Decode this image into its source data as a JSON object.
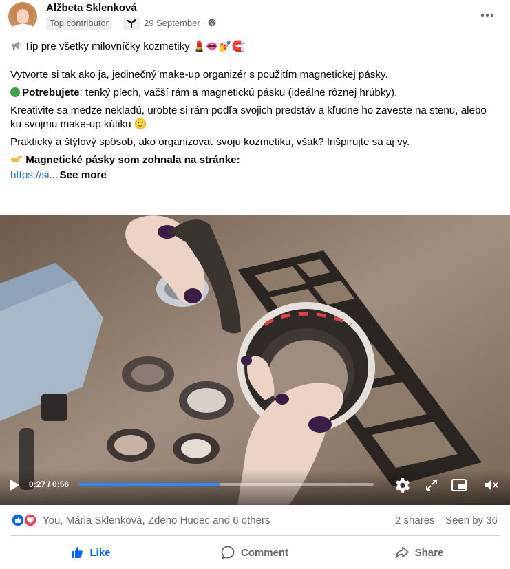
{
  "post": {
    "author": "Alžbeta Sklenková",
    "badge": "Top contributor",
    "date": "29 September",
    "separator": "·",
    "headline": "Tip pre všetky milovníčky kozmetiky",
    "headline_emojis": "💄👄💅🧲",
    "para1": "Vytvorte si tak ako ja, jedinečný make-up organizér s použitím magnetickej pásky.",
    "para2_bold": "Potrebujete",
    "para2_rest": ": tenký plech, väčší rám a magnetickú pásku (ideálne rôznej hrúbky).",
    "para3": "Kreativite sa medze nekladú, urobte si rám podľa svojich predstáv a kľudne ho zaveste na stenu, alebo ku svojmu make-up kútiku 🙂",
    "para4": "Praktický a štýlový spôsob, ako organizovať svoju kozmetiku, však? Inšpirujte sa aj vy.",
    "para5_bold": "Magnetické pásky som zohnala na stránke:",
    "link_text": "https://si",
    "ellipsis": "...",
    "see_more": "See more"
  },
  "video": {
    "current_time": "0:27",
    "duration": "0:56",
    "time_separator": " / ",
    "progress": 0.48
  },
  "reactions": {
    "summary": "You, Mária Sklenková, Zdeno Hudec and 6 others",
    "shares": "2 shares",
    "seen": "Seen by 36"
  },
  "actions": {
    "like": "Like",
    "comment": "Comment",
    "share": "Share"
  },
  "colors": {
    "like_blue": "#0866ff",
    "link_blue": "#216fdb",
    "progress_blue": "#2d88ff",
    "love_red": "#f33e58"
  },
  "icons": [
    "more-dots-icon",
    "globe-icon",
    "sprout-icon",
    "megaphone-icon",
    "green-circle-icon",
    "point-right-icon",
    "play-icon",
    "settings-icon",
    "fullscreen-icon",
    "pip-icon",
    "mute-icon",
    "like-reaction-icon",
    "love-reaction-icon",
    "thumbs-up-icon",
    "comment-icon",
    "share-icon"
  ]
}
